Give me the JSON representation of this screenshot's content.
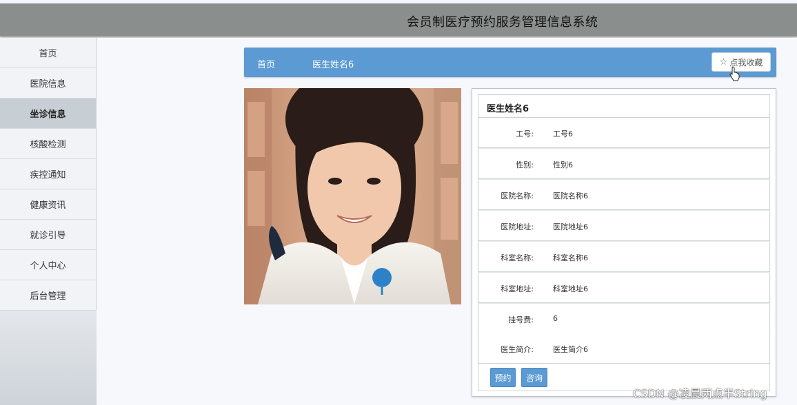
{
  "header": {
    "title": "会员制医疗预约服务管理信息系统"
  },
  "sidebar": {
    "items": [
      {
        "label": "首页"
      },
      {
        "label": "医院信息"
      },
      {
        "label": "坐诊信息",
        "active": true
      },
      {
        "label": "核酸检测"
      },
      {
        "label": "疾控通知"
      },
      {
        "label": "健康资讯"
      },
      {
        "label": "就诊引导"
      },
      {
        "label": "个人中心"
      },
      {
        "label": "后台管理"
      }
    ]
  },
  "breadcrumb": {
    "home": "首页",
    "current": "医生姓名6"
  },
  "favorite_button": {
    "label": "点我收藏",
    "icon": "star-outline-icon"
  },
  "detail": {
    "title": "医生姓名6",
    "rows": [
      {
        "label": "工号:",
        "value": "工号6"
      },
      {
        "label": "性别:",
        "value": "性别6"
      },
      {
        "label": "医院名称:",
        "value": "医院名称6"
      },
      {
        "label": "医院地址:",
        "value": "医院地址6"
      },
      {
        "label": "科室名称:",
        "value": "科室名称6"
      },
      {
        "label": "科室地址:",
        "value": "科室地址6"
      },
      {
        "label": "挂号费:",
        "value": "6"
      },
      {
        "label": "医生简介:",
        "value": "医生简介6"
      }
    ],
    "actions": {
      "book": "预约",
      "consult": "咨询"
    }
  },
  "watermark": "CSDN @凌晨两点半String",
  "colors": {
    "header": "#8a8f8d",
    "accent": "#5b9ad3",
    "sidebar_active": "#c7ced4"
  }
}
